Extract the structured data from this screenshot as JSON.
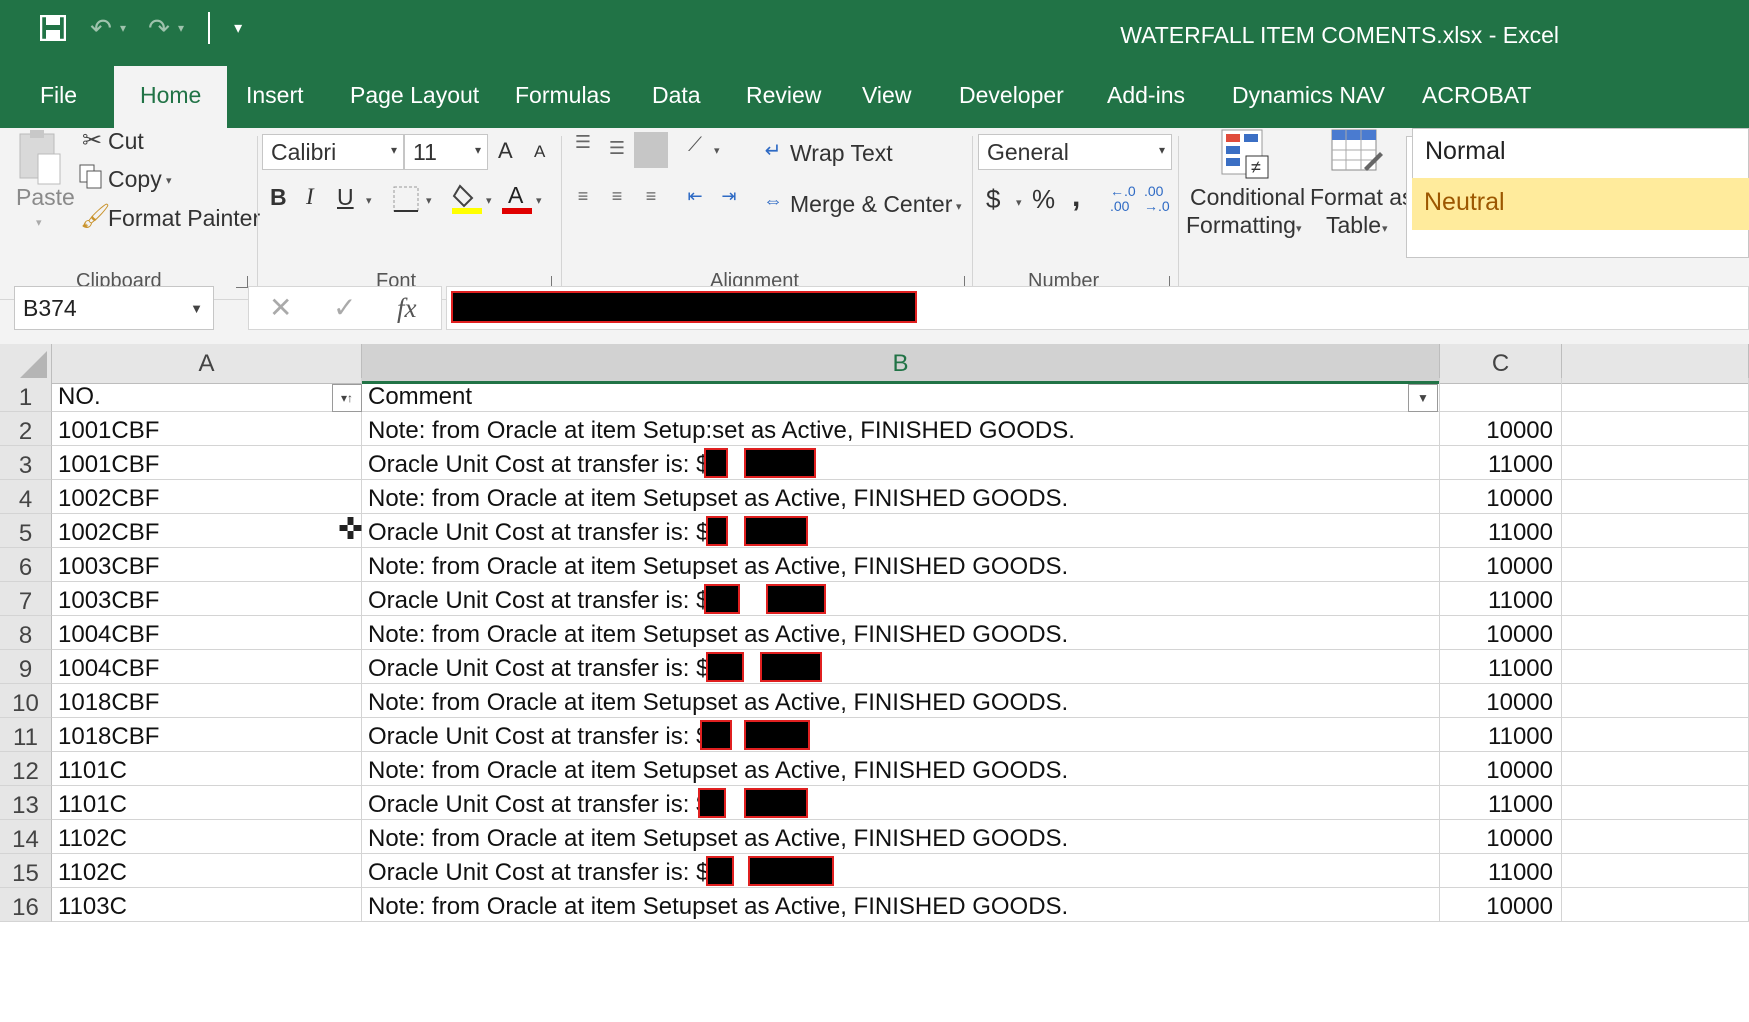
{
  "window": {
    "title": "WATERFALL ITEM COMENTS.xlsx  -  Excel"
  },
  "qat": {
    "save_icon": "save-icon",
    "undo_icon": "undo-icon",
    "redo_icon": "redo-icon"
  },
  "tabs": [
    "File",
    "Home",
    "Insert",
    "Page Layout",
    "Formulas",
    "Data",
    "Review",
    "View",
    "Developer",
    "Add-ins",
    "Dynamics NAV",
    "ACROBAT"
  ],
  "ribbon": {
    "clipboard": {
      "paste": "Paste",
      "cut": "Cut",
      "copy": "Copy",
      "format_painter": "Format Painter",
      "label": "Clipboard"
    },
    "font": {
      "name": "Calibri",
      "size": "11",
      "grow": "A",
      "shrink": "A",
      "bold": "B",
      "italic": "I",
      "underline": "U",
      "font_color_letter": "A",
      "label": "Font"
    },
    "alignment": {
      "wrap_text": "Wrap Text",
      "merge_center": "Merge & Center",
      "label": "Alignment"
    },
    "number": {
      "format": "General",
      "currency": "$",
      "percent": "%",
      "comma": ",",
      "inc_dec": "←.0\n.00",
      "dec_dec": ".00\n→.0",
      "label": "Number"
    },
    "styles": {
      "conditional": "Conditional",
      "formatting": "Formatting",
      "format_as": "Format as",
      "table": "Table",
      "normal": "Normal",
      "neutral": "Neutral"
    }
  },
  "formula_bar": {
    "name_box": "B374",
    "cancel": "✕",
    "enter": "✓",
    "fx": "fx"
  },
  "sheet": {
    "columns": [
      "A",
      "B",
      "C"
    ],
    "header_row": {
      "a": "NO.",
      "b": "Comment"
    },
    "rows": [
      {
        "n": "2",
        "a": "1001CBF",
        "b": "Note: from Oracle at item Setup:set as  Active, FINISHED GOODS.",
        "c": "10000"
      },
      {
        "n": "3",
        "a": "1001CBF",
        "b": "Oracle Unit Cost at transfer is: $",
        "c": "11000"
      },
      {
        "n": "4",
        "a": "1002CBF",
        "b": "Note: from Oracle at item Setupset as  Active, FINISHED GOODS.",
        "c": "10000"
      },
      {
        "n": "5",
        "a": "1002CBF",
        "b": "Oracle Unit Cost at transfer is: $",
        "c": "11000"
      },
      {
        "n": "6",
        "a": "1003CBF",
        "b": "Note: from Oracle at item Setupset as  Active, FINISHED GOODS.",
        "c": "10000"
      },
      {
        "n": "7",
        "a": "1003CBF",
        "b": "Oracle Unit Cost at transfer is: $",
        "c": "11000"
      },
      {
        "n": "8",
        "a": "1004CBF",
        "b": "Note: from Oracle at item Setupset as  Active, FINISHED GOODS.",
        "c": "10000"
      },
      {
        "n": "9",
        "a": "1004CBF",
        "b": "Oracle Unit Cost at transfer is: $",
        "c": "11000"
      },
      {
        "n": "10",
        "a": "1018CBF",
        "b": "Note: from Oracle at item Setupset as  Active, FINISHED GOODS.",
        "c": "10000"
      },
      {
        "n": "11",
        "a": "1018CBF",
        "b": "Oracle Unit Cost at transfer is: $",
        "c": "11000"
      },
      {
        "n": "12",
        "a": "1101C",
        "b": "Note: from Oracle at item Setupset as  Active, FINISHED GOODS.",
        "c": "10000"
      },
      {
        "n": "13",
        "a": "1101C",
        "b": "Oracle Unit Cost at transfer is: $",
        "c": "11000"
      },
      {
        "n": "14",
        "a": "1102C",
        "b": "Note: from Oracle at item Setupset as  Active, FINISHED GOODS.",
        "c": "10000"
      },
      {
        "n": "15",
        "a": "1102C",
        "b": "Oracle Unit Cost at transfer is: $",
        "c": "11000"
      },
      {
        "n": "16",
        "a": "1103C",
        "b": "Note: from Oracle at item Setupset as  Active, FINISHED GOODS.",
        "c": "10000"
      }
    ]
  },
  "colors": {
    "excel_green": "#217346",
    "redaction": "#000000",
    "redaction_border": "#e02020",
    "neutral_fill": "#ffeb9c"
  }
}
